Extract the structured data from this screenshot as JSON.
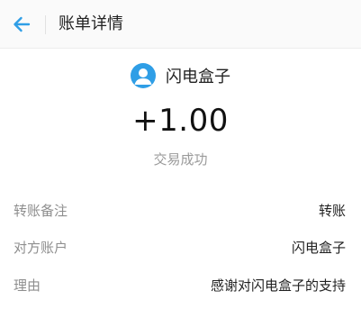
{
  "header": {
    "back_icon": "arrow-left-icon",
    "title": "账单详情",
    "accent_color": "#2f9ee6"
  },
  "payee": {
    "avatar_icon": "user-avatar-icon",
    "name": "闪电盒子"
  },
  "transaction": {
    "amount": "+1.00",
    "status": "交易成功"
  },
  "details": [
    {
      "label": "转账备注",
      "value": "转账"
    },
    {
      "label": "对方账户",
      "value": "闪电盒子"
    },
    {
      "label": "理由",
      "value": "感谢对闪电盒子的支持"
    }
  ]
}
